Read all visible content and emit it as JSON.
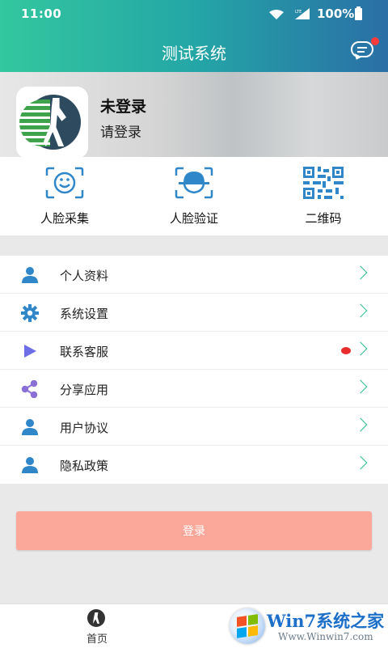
{
  "status_bar": {
    "time": "11:00",
    "battery": "100%"
  },
  "header": {
    "title": "测试系统"
  },
  "profile": {
    "name": "未登录",
    "subtitle": "请登录"
  },
  "quick_actions": [
    {
      "label": "人脸采集",
      "icon": "face-capture-icon"
    },
    {
      "label": "人脸验证",
      "icon": "face-verify-icon"
    },
    {
      "label": "二维码",
      "icon": "qr-code-icon"
    }
  ],
  "menu": [
    {
      "label": "个人资料",
      "icon": "person-icon",
      "badge": false
    },
    {
      "label": "系统设置",
      "icon": "gear-icon",
      "badge": false
    },
    {
      "label": "联系客服",
      "icon": "play-icon",
      "badge": true
    },
    {
      "label": "分享应用",
      "icon": "share-icon",
      "badge": false
    },
    {
      "label": "用户协议",
      "icon": "person-icon",
      "badge": false
    },
    {
      "label": "隐私政策",
      "icon": "person-icon",
      "badge": false
    }
  ],
  "login_button": {
    "label": "登录"
  },
  "bottom_nav": {
    "home_label": "首页"
  },
  "watermark": {
    "title": "Win7系统之家",
    "url": "Www.Winwin7.com"
  },
  "colors": {
    "accent": "#2bbf8a",
    "icon_blue": "#2f86c8",
    "login": "#fba89a",
    "badge": "#e82c2c"
  }
}
